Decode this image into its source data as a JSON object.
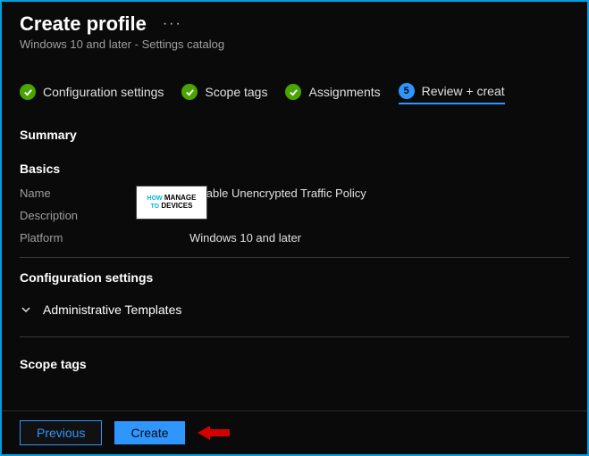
{
  "header": {
    "title": "Create profile",
    "subtitle": "Windows 10 and later - Settings catalog"
  },
  "steps": {
    "s1": "Configuration settings",
    "s2": "Scope tags",
    "s3": "Assignments",
    "s4_num": "5",
    "s4_label": "Review + creat"
  },
  "summary": {
    "heading": "Summary",
    "basics": {
      "title": "Basics",
      "name_key": "Name",
      "name_val": "Disable Unencrypted Traffic Policy",
      "desc_key": "Description",
      "desc_val": "--",
      "platform_key": "Platform",
      "platform_val": "Windows 10 and later"
    },
    "config_title": "Configuration settings",
    "admin_templates": "Administrative Templates",
    "scope_title": "Scope tags"
  },
  "footer": {
    "previous": "Previous",
    "create": "Create"
  },
  "watermark": {
    "line1": "HOW",
    "line2": "MANAGE",
    "line3": "TO",
    "line4": "DEVICES"
  }
}
